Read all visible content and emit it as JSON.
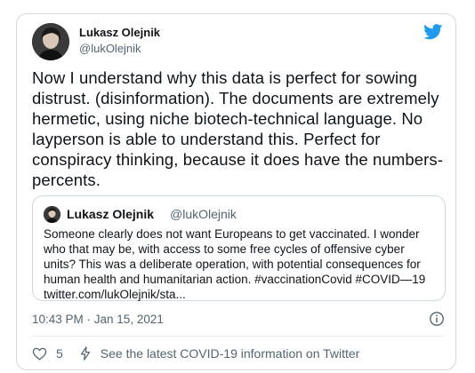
{
  "tweet": {
    "author_name": "Lukasz Olejnik",
    "author_handle": "@lukOlejnik",
    "text": "Now I understand why this data is perfect for sowing distrust. (disinformation). The documents are extremely hermetic, using niche biotech-technical language. No layperson is able to understand this. Perfect for conspiracy thinking, because it does have the numbers-percents.",
    "timestamp": "10:43 PM · Jan 15, 2021",
    "like_count": "5",
    "covid_link": "See the latest COVID-19 information on Twitter"
  },
  "quoted": {
    "author_name": "Lukasz Olejnik",
    "author_handle": "@lukOlejnik",
    "text": "Someone clearly does not want Europeans to get vaccinated. I wonder who that may be, with access to some free cycles of offensive cyber units? This was a deliberate operation, with potential consequences for human health and humanitarian action. #vaccinationCovid #COVID—19 twitter.com/lukOlejnik/sta..."
  },
  "colors": {
    "twitter_blue": "#1d9bf0",
    "secondary_text": "#536471",
    "border": "#cfd9de"
  },
  "icons": [
    "twitter-bird-icon",
    "info-icon",
    "heart-icon",
    "lightning-icon"
  ]
}
